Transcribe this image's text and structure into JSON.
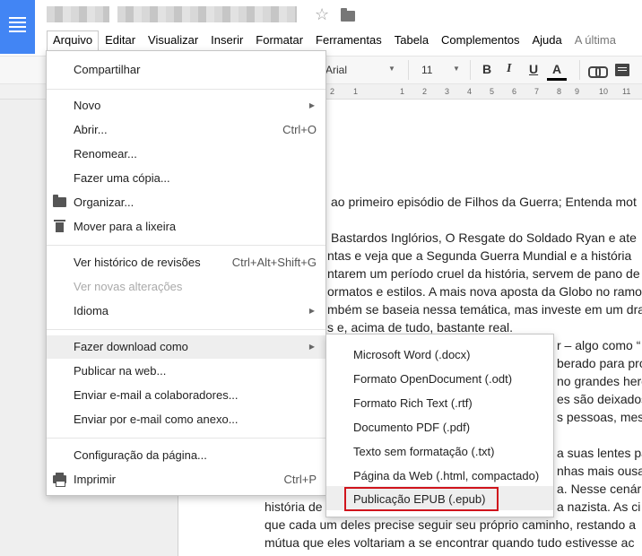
{
  "title_bar": {
    "star_icon": "star-icon",
    "folder_icon": "folder-icon"
  },
  "menubar": {
    "items": [
      {
        "label": "Arquivo",
        "active": true
      },
      {
        "label": "Editar"
      },
      {
        "label": "Visualizar"
      },
      {
        "label": "Inserir"
      },
      {
        "label": "Formatar"
      },
      {
        "label": "Ferramentas"
      },
      {
        "label": "Tabela"
      },
      {
        "label": "Complementos"
      },
      {
        "label": "Ajuda"
      }
    ],
    "last_edit": "A última"
  },
  "toolbar": {
    "font": "Arial",
    "size": "11",
    "bold": "B",
    "italic": "I",
    "underline": "U",
    "text_color": "A"
  },
  "ruler": {
    "ticks": [
      "2",
      "1",
      "1",
      "2",
      "3",
      "4",
      "5",
      "6",
      "7",
      "8",
      "9",
      "10",
      "11"
    ]
  },
  "file_menu": {
    "share": "Compartilhar",
    "new": "Novo",
    "open": "Abrir...",
    "open_sc": "Ctrl+O",
    "rename": "Renomear...",
    "copy": "Fazer uma cópia...",
    "organize": "Organizar...",
    "trash": "Mover para a lixeira",
    "revisions": "Ver histórico de revisões",
    "revisions_sc": "Ctrl+Alt+Shift+G",
    "new_changes": "Ver novas alterações",
    "language": "Idioma",
    "download": "Fazer download como",
    "publish": "Publicar na web...",
    "email_collab": "Enviar e-mail a colaboradores...",
    "email_attach": "Enviar por e-mail como anexo...",
    "page_setup": "Configuração da página...",
    "print": "Imprimir",
    "print_sc": "Ctrl+P"
  },
  "download_menu": {
    "items": [
      "Microsoft Word (.docx)",
      "Formato OpenDocument (.odt)",
      "Formato Rich Text (.rtf)",
      "Documento PDF (.pdf)",
      "Texto sem formatação (.txt)",
      "Página da Web (.html, compactado)",
      "Publicação EPUB (.epub)"
    ],
    "highlight_color": "#d0141c"
  },
  "document": {
    "lines": [
      "ao primeiro episódio de Filhos da Guerra; Entenda mot",
      "Bastardos Inglórios, O Resgate do Soldado Ryan e ate",
      "ntas e veja que a Segunda Guerra Mundial e a história",
      "ntarem um período cruel da história, servem de pano de",
      "ormatos e estilos. A mais nova aposta da Globo no ramo",
      "mbém se baseia nessa temática, mas investe em um dra",
      "s e, acima de tudo, bastante real.",
      "r – algo como “",
      "berado para pro",
      "no grandes heró",
      "es são deixados",
      "s pessoas, mesm",
      "a suas lentes pa",
      "nhas mais ousa",
      "a. Nesse cenár",
      "história de",
      "a nazista. As ci",
      "que cada um deles precise seguir seu próprio caminho, restando a",
      "mútua que eles voltariam a se encontrar quando tudo estivesse ac"
    ]
  }
}
